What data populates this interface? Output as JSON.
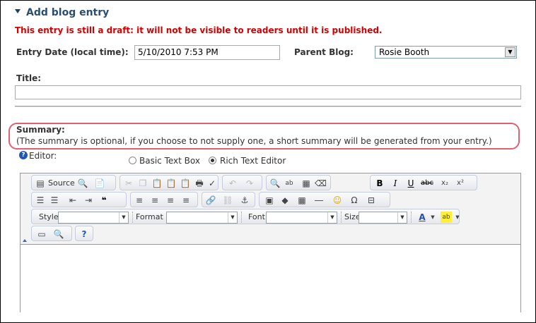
{
  "header": {
    "title": "Add blog entry"
  },
  "warning": "This entry is still a draft: it will not be visible to readers until it is published.",
  "entry_date": {
    "label": "Entry Date (local time):",
    "value": "5/10/2010 7:53 PM"
  },
  "parent_blog": {
    "label": "Parent Blog:",
    "value": "Rosie Booth"
  },
  "title_field": {
    "label": "Title:",
    "value": ""
  },
  "summary": {
    "label": "Summary:",
    "help": "(The summary is optional, if you choose to not supply one, a short summary will be generated from your entry.)"
  },
  "editor": {
    "label": "Editor:",
    "options": [
      {
        "label": "Basic Text Box",
        "selected": false
      },
      {
        "label": "Rich Text Editor",
        "selected": true
      }
    ],
    "toolbar": {
      "source_label": "Source",
      "style_label": "Style",
      "format_label": "Format",
      "font_label": "Font",
      "size_label": "Size"
    }
  },
  "colors": {
    "accent": "#2b4d6e",
    "warning": "#d20000",
    "highlight_border": "#e06070"
  }
}
